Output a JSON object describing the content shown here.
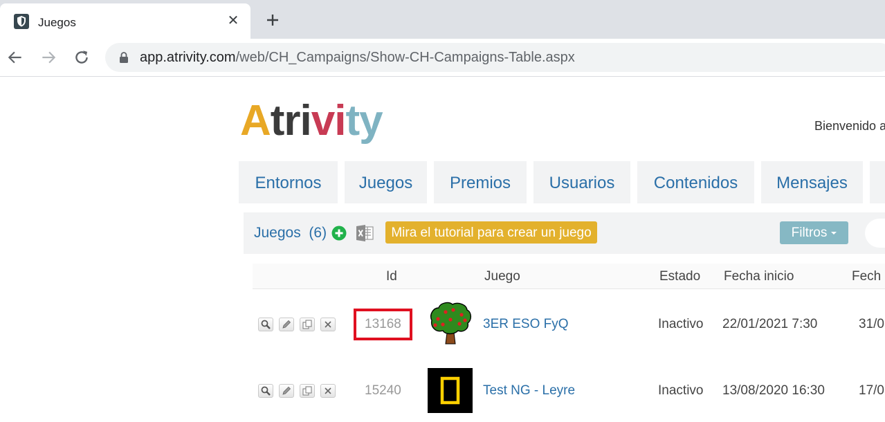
{
  "browser": {
    "tab_title": "Juegos",
    "url_host": "app.atrivity.com",
    "url_path": "/web/CH_Campaigns/Show-CH-Campaigns-Table.aspx"
  },
  "header": {
    "logo_letters": [
      "A",
      "tri",
      "vi",
      "ty"
    ],
    "logo_colors": [
      "#e8a826",
      "#3b3b3b",
      "#c83b54",
      "#7fb3c2"
    ],
    "welcome_text": "Bienvenido a"
  },
  "menu": [
    "Entornos",
    "Juegos",
    "Premios",
    "Usuarios",
    "Contenidos",
    "Mensajes"
  ],
  "subbar": {
    "title": "Juegos",
    "count": "(6)",
    "tutorial_label": "Mira el tutorial para crear un juego",
    "filters_label": "Filtros"
  },
  "table": {
    "headers": {
      "id": "Id",
      "game": "Juego",
      "status": "Estado",
      "start": "Fecha inicio",
      "end": "Fech"
    },
    "rows": [
      {
        "id": "13168",
        "name": "3ER ESO FyQ",
        "status": "Inactivo",
        "start": "22/01/2021 7:30",
        "end": "31/0",
        "thumb": "tree-icon",
        "highlight": true
      },
      {
        "id": "15240",
        "name": "Test NG - Leyre",
        "status": "Inactivo",
        "start": "13/08/2020 16:30",
        "end": "17/0",
        "thumb": "national-geographic-icon",
        "highlight": false
      }
    ]
  },
  "colors": {
    "link": "#2a6fa8",
    "tutorial": "#e3b12d",
    "filters": "#86b8c4",
    "highlight": "#e01020"
  }
}
